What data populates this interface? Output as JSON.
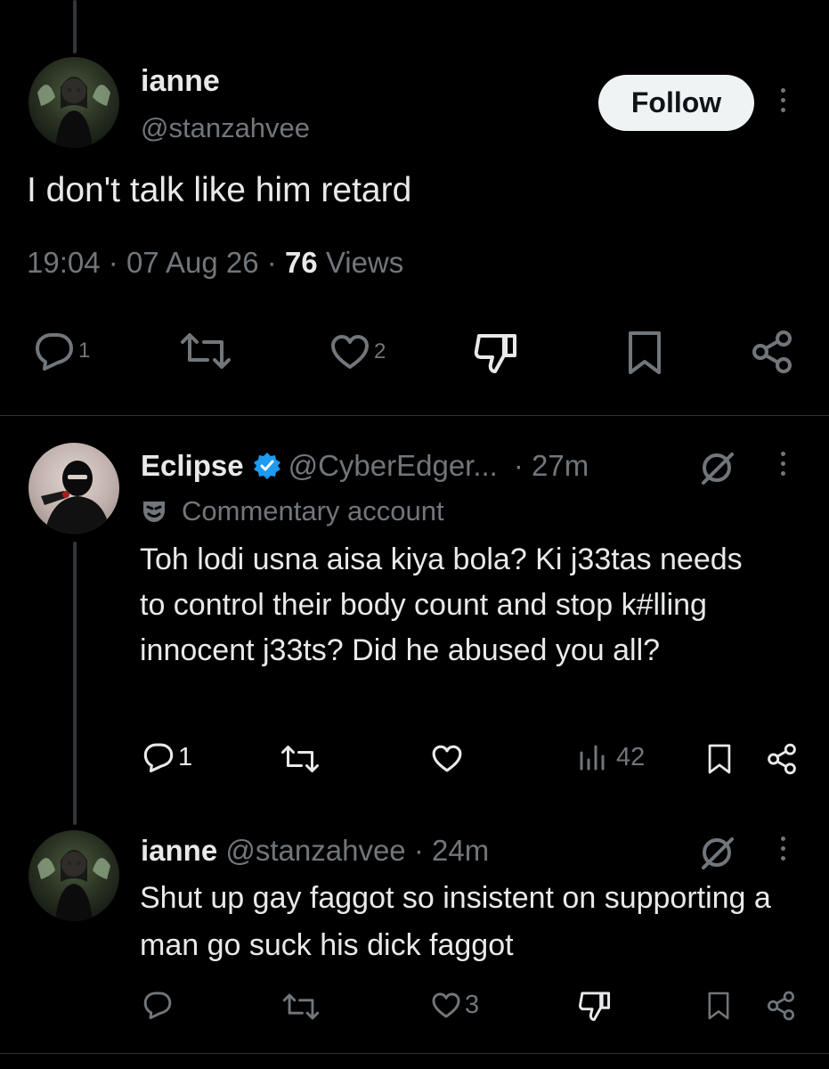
{
  "tweet": {
    "display_name": "ianne",
    "handle": "@stanzahvee",
    "follow_label": "Follow",
    "text": "I don't talk like him retard",
    "time": "19:04",
    "dot": "·",
    "date": "07 Aug 26",
    "views_count": "76",
    "views_label": "Views",
    "reply_count": "1",
    "like_count": "2"
  },
  "reply1": {
    "display_name": "Eclipse",
    "handle": "@CyberEdger...",
    "time": "· 27m",
    "label": "Commentary account",
    "text": "Toh lodi usna aisa kiya bola? Ki j33tas needs to control their body count and stop k#lling innocent j33ts? Did he abused you all?",
    "reply_count": "1",
    "views_count": "42"
  },
  "reply2": {
    "display_name": "ianne",
    "handle_time": "@stanzahvee · 24m",
    "text": "Shut up gay faggot so insistent on supporting a man go suck his dick faggot",
    "like_count": "3"
  },
  "colors": {
    "background": "#000000",
    "text": "#e7e9ea",
    "muted": "#71767b",
    "verified": "#1d9bf0",
    "follow_bg": "#eff3f4"
  }
}
